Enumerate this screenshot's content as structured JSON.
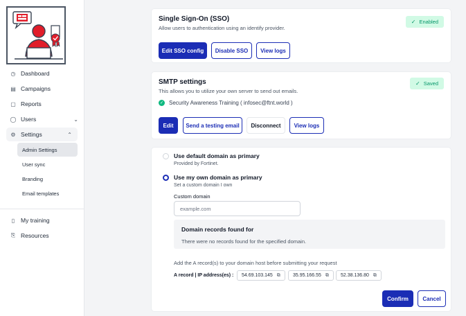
{
  "sidebar": {
    "items": [
      {
        "label": "Dashboard",
        "icon": "dashboard-icon"
      },
      {
        "label": "Campaigns",
        "icon": "campaigns-icon"
      },
      {
        "label": "Reports",
        "icon": "reports-icon"
      },
      {
        "label": "Users",
        "icon": "users-icon"
      },
      {
        "label": "Settings",
        "icon": "gear-icon"
      }
    ],
    "settings_sub": [
      "Admin Settings",
      "User sync",
      "Branding",
      "Email templates"
    ],
    "bottom_items": [
      {
        "label": "My training",
        "icon": "training-icon"
      },
      {
        "label": "Resources",
        "icon": "resources-icon"
      }
    ]
  },
  "sso": {
    "title": "Single Sign-On (SSO)",
    "subtitle": "Allow users to authentication using an identify provider.",
    "badge": "Enabled",
    "buttons": {
      "edit": "Edit SSO config",
      "disable": "Disable SSO",
      "logs": "View logs"
    }
  },
  "smtp": {
    "title": "SMTP settings",
    "subtitle": "This allows you to utilize your own server to send out emails.",
    "badge": "Saved",
    "sender": "Security Awareness Training ( infosec@ftnt.world )",
    "buttons": {
      "edit": "Edit",
      "test": "Send a testing email",
      "disconnect": "Disconnect",
      "logs": "View logs"
    }
  },
  "domain": {
    "option_default": {
      "title": "Use default domain as primary",
      "desc": "Provided by Fortinet."
    },
    "option_own": {
      "title": "Use my own domain as primary",
      "desc": "Set a custom domain I own"
    },
    "custom_label": "Custom domain",
    "custom_placeholder": "example.com",
    "records_title": "Domain records found for",
    "records_desc": "There were no records found for the specified domain.",
    "hint": "Add the A record(s) to your domain host before submitting your request",
    "arecord_label": "A record | IP address(es) :",
    "ips": [
      "54.69.103.145",
      "35.95.166.55",
      "52.38.136.80"
    ],
    "confirm": "Confirm",
    "cancel": "Cancel"
  },
  "colors": {
    "primary": "#1b2db5",
    "success_bg": "#d1fae5",
    "success": "#059669",
    "logo_red": "#e11d2a"
  }
}
